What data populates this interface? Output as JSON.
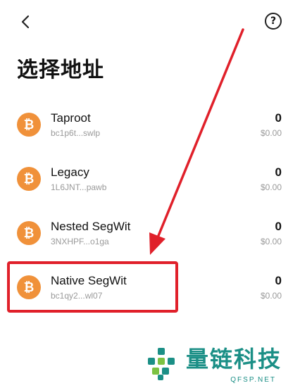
{
  "header": {
    "back_icon": "chevron-left-icon",
    "help_icon": "question-circle-icon",
    "help_glyph": "?"
  },
  "page_title": "选择地址",
  "coin_icon": "bitcoin-icon",
  "coin_color": "#f0913a",
  "addresses": [
    {
      "name": "Taproot",
      "address": "bc1p6t...swlp",
      "balance": "0",
      "fiat": "$0.00"
    },
    {
      "name": "Legacy",
      "address": "1L6JNT...pawb",
      "balance": "0",
      "fiat": "$0.00"
    },
    {
      "name": "Nested SegWit",
      "address": "3NXHPF...o1ga",
      "balance": "0",
      "fiat": "$0.00"
    },
    {
      "name": "Native SegWit",
      "address": "bc1qy2...wl07",
      "balance": "0",
      "fiat": "$0.00"
    }
  ],
  "annotation_color": "#e0202a",
  "watermark": {
    "text": "量链科技",
    "sub": "QFSP.NET",
    "color": "#1b8f86"
  }
}
